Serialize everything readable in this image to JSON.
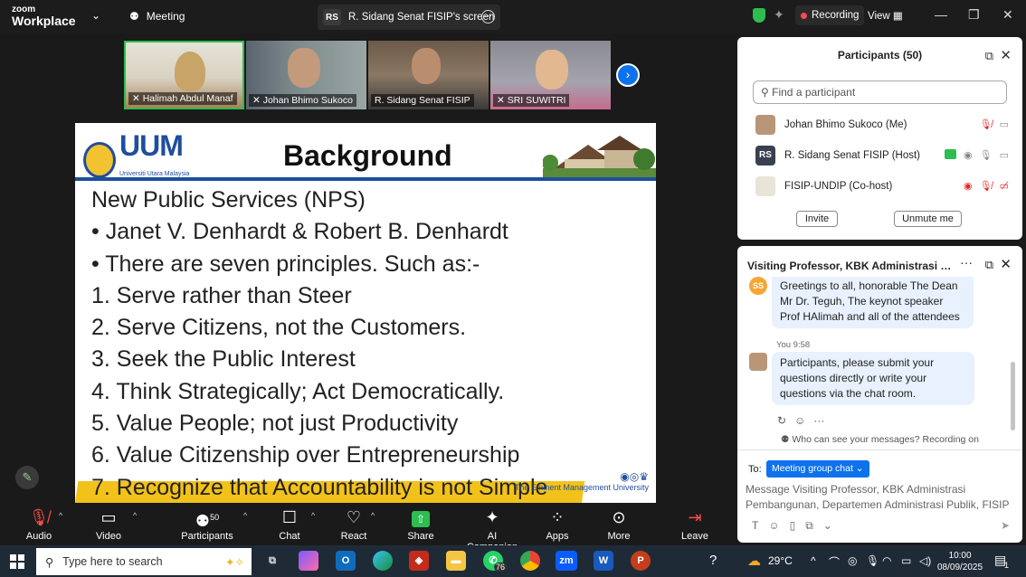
{
  "titlebar": {
    "logo_top": "zoom",
    "logo_bottom": "Workplace",
    "meeting_label": "Meeting",
    "share_badge": "RS",
    "share_tab_label": "R. Sidang Senat FISIP's screen",
    "recording_label": "Recording",
    "view_label": "View",
    "minimize": "—",
    "maximize": "❐",
    "close": "✕"
  },
  "thumbnails": [
    {
      "name": "Halimah Abdul Manaf"
    },
    {
      "name": "Johan Bhimo Sukoco"
    },
    {
      "name": "R. Sidang Senat FISIP"
    },
    {
      "name": "SRI SUWITRI"
    }
  ],
  "slide": {
    "logo_text": "UUM",
    "logo_sub": "Universiti Utara Malaysia",
    "title": "Background",
    "lines": [
      "New Public Services (NPS)",
      "•  Janet V. Denhardt & Robert B. Denhardt",
      "•  There are seven principles. Such as:-",
      "1. Serve rather than Steer",
      "2. Serve Citizens, not the Customers.",
      "3. Seek the Public Interest",
      "4. Think Strategically; Act Democratically.",
      "5. Value People; not just Productivity",
      "6. Value Citizenship over Entrepreneurship",
      "7. Recognize that Accountability is not Simple"
    ],
    "footer": "The Eminent Management University"
  },
  "participants": {
    "title": "Participants (50)",
    "search_placeholder": "Find a participant",
    "list": [
      {
        "name": "Johan Bhimo Sukoco (Me)"
      },
      {
        "name": "R. Sidang Senat FISIP (Host)",
        "badge": "RS"
      },
      {
        "name": "FISIP-UNDIP (Co-host)"
      }
    ],
    "invite": "Invite",
    "unmute": "Unmute me"
  },
  "chat": {
    "title": "Visiting Professor, KBK Administrasi Pembangunan, Departemen Administrasi Publik, FISIP",
    "msg1_avatar": "SS",
    "msg1": "Greetings to all, honorable The Dean Mr Dr. Teguh, The keynot speaker Prof HAlimah and all of the attendees",
    "msg2_sender": "You",
    "msg2_time": "9:58",
    "msg2": "Participants, please submit your questions directly or write your questions via the chat room.",
    "visibility_note": "Who can see your messages? Recording on",
    "to_label": "To:",
    "to_value": "Meeting group chat ⌄",
    "input_placeholder": "Message Visiting Professor, KBK Administrasi Pembangunan, Departemen Administrasi Publik, FISIP"
  },
  "toolbar": {
    "audio": "Audio",
    "video": "Video",
    "participants": "Participants",
    "participants_count": "50",
    "chat": "Chat",
    "react": "React",
    "share": "Share",
    "ai_companion": "AI Companion",
    "apps": "Apps",
    "more": "More",
    "leave": "Leave"
  },
  "taskbar": {
    "search_placeholder": "Type here to search",
    "whatsapp_badge": "76",
    "weather": "29°C",
    "time": "10:00",
    "date": "08/09/2025",
    "notif_count": "1"
  },
  "colors": {
    "zoom_blue": "#0e72ed",
    "active_green": "#2dbe4f",
    "recording_red": "#ff4b4b",
    "uum_blue": "#1f4e9c",
    "highlight_yellow": "#f3c21a"
  }
}
